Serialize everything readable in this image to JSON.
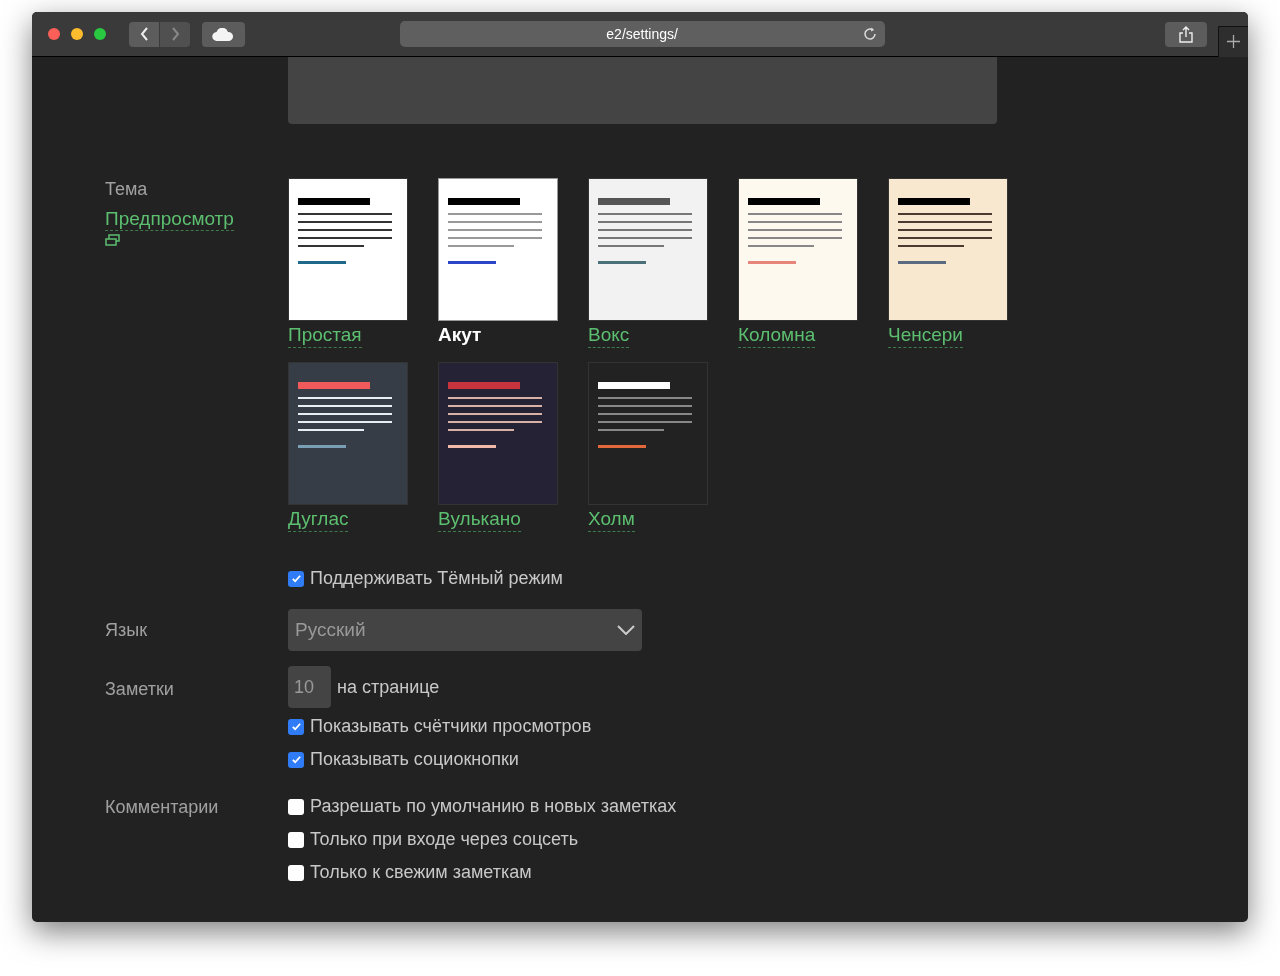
{
  "browser": {
    "address": "e2/settings/"
  },
  "theme_section": {
    "label": "Тема",
    "preview_link": "Предпросмотр",
    "themes": [
      {
        "name": "Простая",
        "selected": false,
        "color": "#ffffff"
      },
      {
        "name": "Акут",
        "selected": true,
        "color": "#ffffff"
      },
      {
        "name": "Вокс",
        "selected": false,
        "color": "#f2f2f2"
      },
      {
        "name": "Коломна",
        "selected": false,
        "color": "#fdf9ef"
      },
      {
        "name": "Ченсери",
        "selected": false,
        "color": "#f9e8d0"
      },
      {
        "name": "Дуглас",
        "selected": false,
        "color": "#363d47"
      },
      {
        "name": "Вулькано",
        "selected": false,
        "color": "#252236"
      },
      {
        "name": "Холм",
        "selected": false,
        "color": "#222222"
      }
    ],
    "dark_mode": {
      "label": "Поддерживать Тёмный режим",
      "checked": true
    }
  },
  "language": {
    "label": "Язык",
    "value": "Русский"
  },
  "notes": {
    "label": "Заметки",
    "per_page": "10",
    "per_page_suffix": "на странице",
    "options": [
      {
        "label": "Показывать счётчики просмотров",
        "checked": true
      },
      {
        "label": "Показывать социокнопки",
        "checked": true
      }
    ]
  },
  "comments": {
    "label": "Комментарии",
    "options": [
      {
        "label": "Разрешать по умолчанию в новых заметках",
        "checked": false
      },
      {
        "label": "Только при входе через соцсеть",
        "checked": false
      },
      {
        "label": "Только к свежим заметкам",
        "checked": false
      }
    ]
  }
}
